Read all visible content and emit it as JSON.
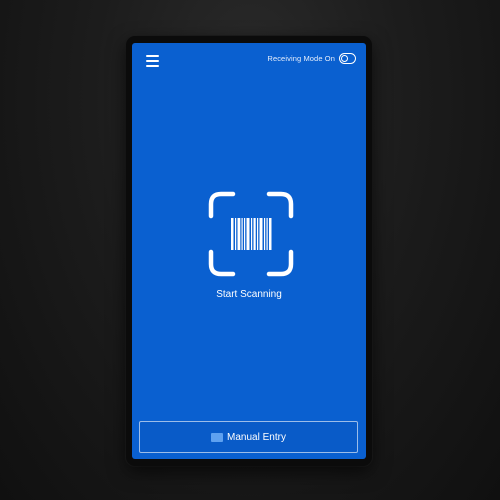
{
  "header": {
    "menu_icon": "hamburger-menu-icon",
    "receiving_mode_label": "Receiving Mode On",
    "receiving_mode_on": false
  },
  "scanner": {
    "icon": "barcode-scan-icon",
    "start_label": "Start Scanning"
  },
  "footer": {
    "manual_entry_label": "Manual Entry",
    "manual_entry_icon": "keyboard-icon"
  },
  "colors": {
    "screen_background": "#0a60d0",
    "foreground": "#ffffff",
    "page_background": "#1c1c1c"
  }
}
